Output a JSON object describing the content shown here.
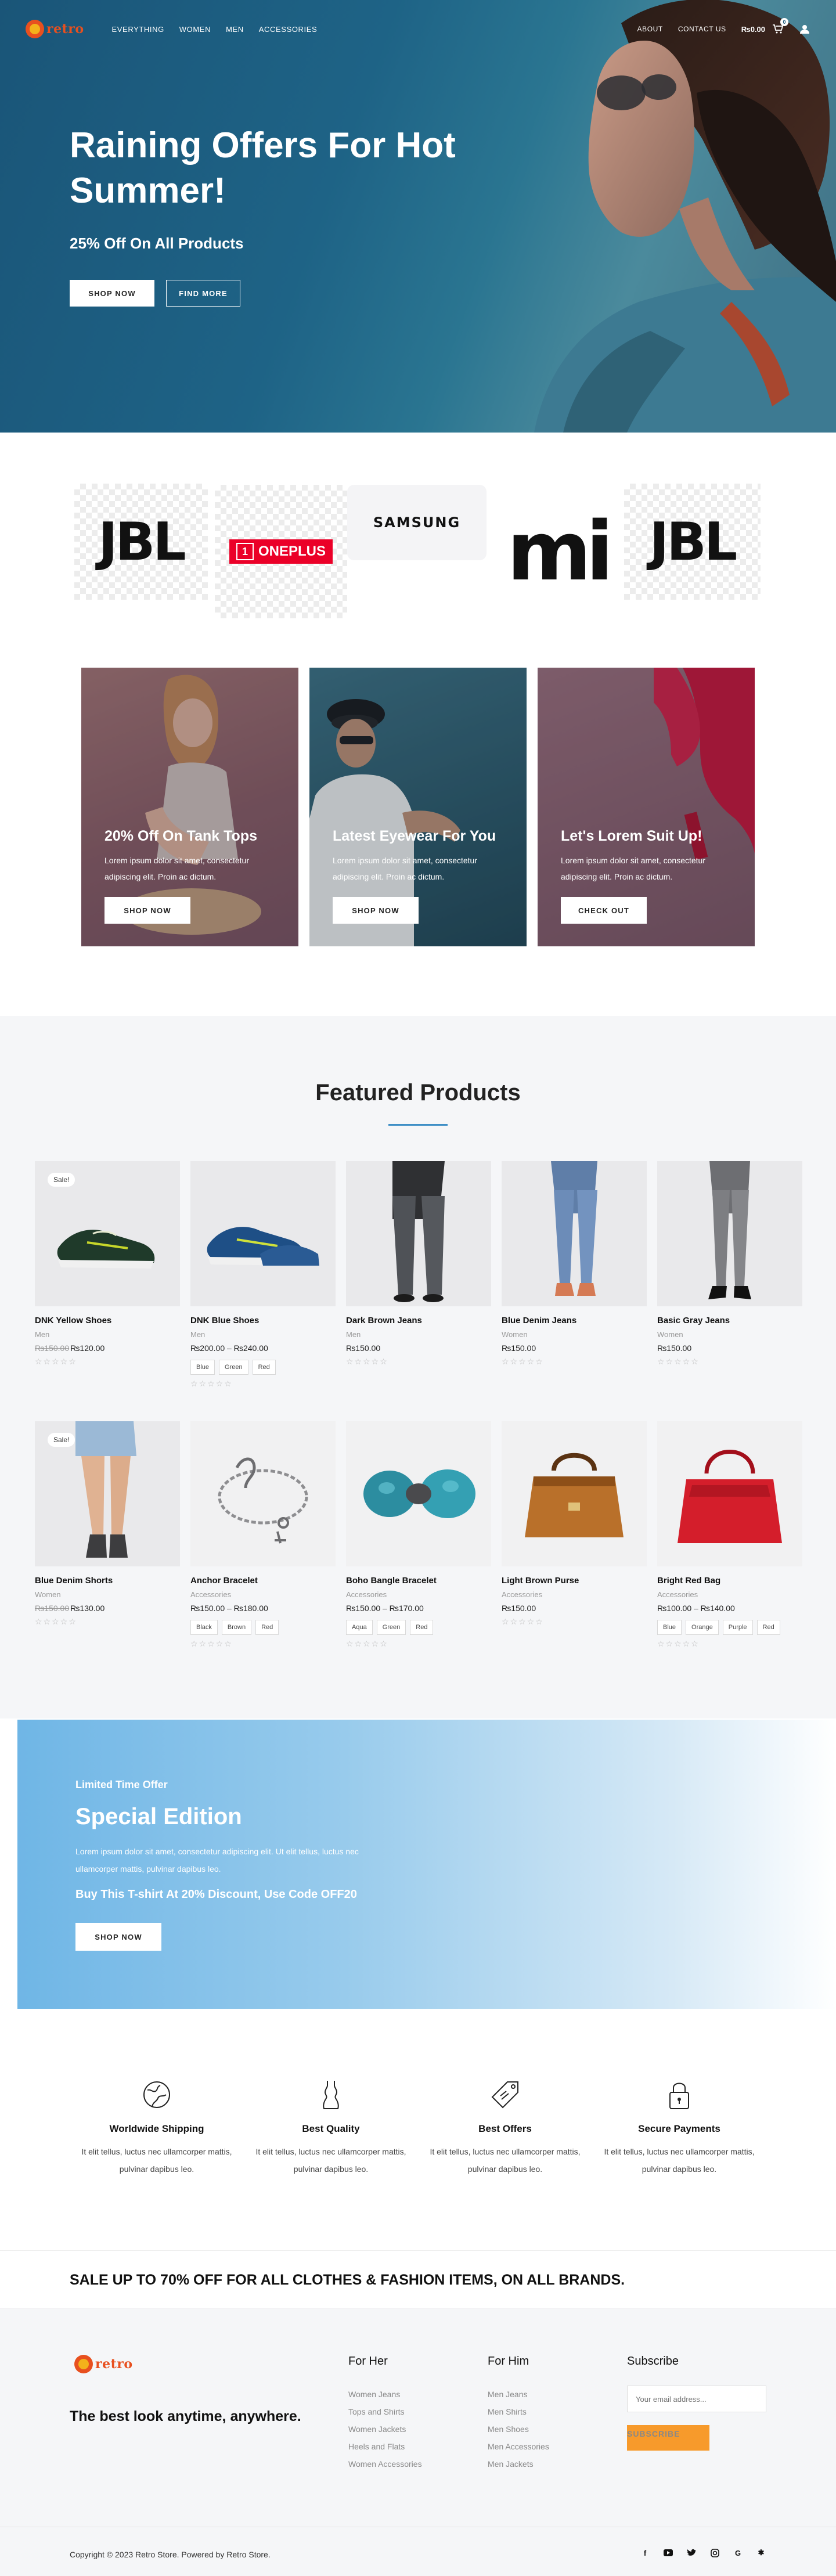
{
  "header": {
    "logo_text": "retro",
    "nav": [
      "EVERYTHING",
      "WOMEN",
      "MEN",
      "ACCESSORIES"
    ],
    "about": "ABOUT",
    "contact": "CONTACT US",
    "cart_total": "₨0.00",
    "cart_count": "0"
  },
  "hero": {
    "title": "Raining Offers For Hot Summer!",
    "subtitle": "25% Off On All Products",
    "shop_now": "SHOP NOW",
    "find_more": "FIND MORE"
  },
  "brands": {
    "jbl": "JBL",
    "oneplus": "ONEPLUS",
    "samsung": "SAMSUNG",
    "mi": "mi"
  },
  "promos": [
    {
      "title": "20% Off On Tank Tops",
      "text": "Lorem ipsum dolor sit amet, consectetur adipiscing elit. Proin ac dictum.",
      "button": "SHOP NOW"
    },
    {
      "title": "Latest Eyewear For You",
      "text": "Lorem ipsum dolor sit amet, consectetur adipiscing elit. Proin ac dictum.",
      "button": "SHOP NOW"
    },
    {
      "title": "Let's Lorem Suit Up!",
      "text": "Lorem ipsum dolor sit amet, consectetur adipiscing elit. Proin ac dictum.",
      "button": "CHECK OUT"
    }
  ],
  "featured": {
    "title": "Featured Products",
    "sale_label": "Sale!",
    "stars": "☆☆☆☆☆",
    "products": [
      {
        "name": "DNK Yellow Shoes",
        "category": "Men",
        "old_price": "₨150.00",
        "price": "₨120.00",
        "options": []
      },
      {
        "name": "DNK Blue Shoes",
        "category": "Men",
        "old_price": "",
        "price": "₨200.00 – ₨240.00",
        "options": [
          "Blue",
          "Green",
          "Red"
        ]
      },
      {
        "name": "Dark Brown Jeans",
        "category": "Men",
        "old_price": "",
        "price": "₨150.00",
        "options": []
      },
      {
        "name": "Blue Denim Jeans",
        "category": "Women",
        "old_price": "",
        "price": "₨150.00",
        "options": []
      },
      {
        "name": "Basic Gray Jeans",
        "category": "Women",
        "old_price": "",
        "price": "₨150.00",
        "options": []
      },
      {
        "name": "Blue Denim Shorts",
        "category": "Women",
        "old_price": "₨150.00",
        "price": "₨130.00",
        "options": []
      },
      {
        "name": "Anchor Bracelet",
        "category": "Accessories",
        "old_price": "",
        "price": "₨150.00 – ₨180.00",
        "options": [
          "Black",
          "Brown",
          "Red"
        ]
      },
      {
        "name": "Boho Bangle Bracelet",
        "category": "Accessories",
        "old_price": "",
        "price": "₨150.00 – ₨170.00",
        "options": [
          "Aqua",
          "Green",
          "Red"
        ]
      },
      {
        "name": "Light Brown Purse",
        "category": "Accessories",
        "old_price": "",
        "price": "₨150.00",
        "options": []
      },
      {
        "name": "Bright Red Bag",
        "category": "Accessories",
        "old_price": "",
        "price": "₨100.00 – ₨140.00",
        "options": [
          "Blue",
          "Orange",
          "Purple",
          "Red"
        ]
      }
    ]
  },
  "special": {
    "eyebrow": "Limited Time Offer",
    "title": "Special Edition",
    "text": "Lorem ipsum dolor sit amet, consectetur adipiscing elit. Ut elit tellus, luctus nec ullamcorper mattis, pulvinar dapibus leo.",
    "code": "Buy This T-shirt At 20% Discount, Use Code OFF20",
    "button": "SHOP NOW"
  },
  "features": [
    {
      "icon": "globe-icon",
      "title": "Worldwide Shipping",
      "text": "It elit tellus, luctus nec ullamcorper mattis, pulvinar dapibus leo."
    },
    {
      "icon": "dress-icon",
      "title": "Best Quality",
      "text": "It elit tellus, luctus nec ullamcorper mattis, pulvinar dapibus leo."
    },
    {
      "icon": "tag-icon",
      "title": "Best Offers",
      "text": "It elit tellus, luctus nec ullamcorper mattis, pulvinar dapibus leo."
    },
    {
      "icon": "lock-icon",
      "title": "Secure Payments",
      "text": "It elit tellus, luctus nec ullamcorper mattis, pulvinar dapibus leo."
    }
  ],
  "strip": {
    "text": "SALE UP TO 70% OFF FOR ALL CLOTHES & FASHION ITEMS, ON ALL BRANDS."
  },
  "footer": {
    "logo_text": "retro",
    "tagline": "The best look anytime, anywhere.",
    "for_her": {
      "title": "For Her",
      "links": [
        "Women Jeans",
        "Tops and Shirts",
        "Women Jackets",
        "Heels and Flats",
        "Women Accessories"
      ]
    },
    "for_him": {
      "title": "For Him",
      "links": [
        "Men Jeans",
        "Men Shirts",
        "Men Shoes",
        "Men Accessories",
        "Men Jackets"
      ]
    },
    "subscribe": {
      "title": "Subscribe",
      "placeholder": "Your email address...",
      "button": "SUBSCRIBE"
    },
    "copyright": "Copyright © 2023 Retro Store. Powered by Retro Store.",
    "socials": [
      "facebook-icon",
      "youtube-icon",
      "twitter-icon",
      "instagram-icon",
      "google-icon",
      "yelp-icon"
    ]
  },
  "colors": {
    "accent": "#3f8fc6",
    "orange": "#f79a2b",
    "hero": "#1e6386"
  }
}
